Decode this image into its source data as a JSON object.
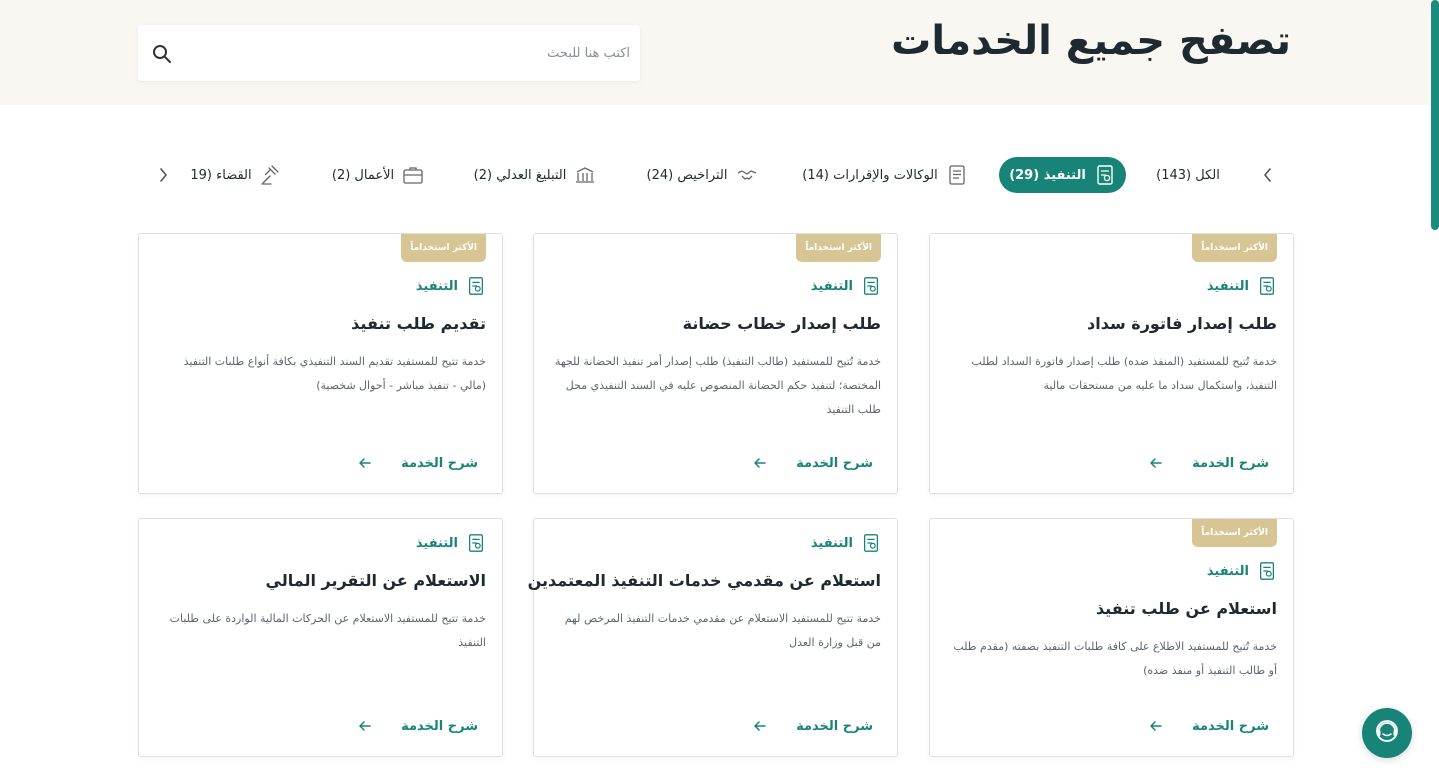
{
  "header": {
    "title": "تصفح جميع الخدمات",
    "search_placeholder": "اكتب هنا للبحث"
  },
  "colors": {
    "primary": "#188478",
    "badge": "#d8c594",
    "header_bg": "#f8f7f2"
  },
  "tabs": [
    {
      "label": "الكل (143)",
      "icon": null,
      "active": false
    },
    {
      "label": "التنفيذ (29)",
      "icon": "execution-doc-icon",
      "active": true
    },
    {
      "label": "الوكالات والإقرارات (14)",
      "icon": "document-lines-icon",
      "active": false
    },
    {
      "label": "التراخيص (24)",
      "icon": "handshake-icon",
      "active": false
    },
    {
      "label": "التبليغ العدلي (2)",
      "icon": "building-icon",
      "active": false
    },
    {
      "label": "الأعمال (2)",
      "icon": "briefcase-icon",
      "active": false
    },
    {
      "label": "القضاء (19",
      "icon": "gavel-icon",
      "active": false
    }
  ],
  "cards": [
    {
      "badge": "الأكثر استخداماً",
      "category": "التنفيذ",
      "title": "طلب إصدار فاتورة سداد",
      "desc": "خدمة تُتيح للمستفيد (المنفذ ضده) طلب إصدار فاتورة السداد لطلب التنفيذ، واستكمال سداد ما عليه من مستحقات مالية",
      "cta": "شرح الخدمة"
    },
    {
      "badge": "الأكثر استخداماً",
      "category": "التنفيذ",
      "title": "طلب إصدار خطاب حضانة",
      "desc": "خدمة تُتيح للمستفيد (طالب التنفيذ) طلب إصدار أمر تنفيذ الحضانة للجهة المختصة؛ لتنفيذ حكم الحضانة المنصوص عليه في السند التنفيذي محل طلب التنفيذ",
      "cta": "شرح الخدمة"
    },
    {
      "badge": "الأكثر استخداماً",
      "category": "التنفيذ",
      "title": "تقديم طلب تنفيذ",
      "desc": "خدمة تتيح للمستفيد تقديم السند التنفيذي بكافة أنواع طلبات التنفيذ (مالي - تنفيذ مباشر - أحوال شخصية)",
      "cta": "شرح الخدمة"
    },
    {
      "badge": "الأكثر استخداماً",
      "category": "التنفيذ",
      "title": "استعلام عن طلب تنفيذ",
      "desc": "خدمة تُتيح للمستفيد الاطلاع على كافة طلبات التنفيذ بصفته (مقدم طلب أو طالب التنفيذ أو منفذ ضده)",
      "cta": "شرح الخدمة"
    },
    {
      "badge": null,
      "category": "التنفيذ",
      "title": "استعلام عن مقدمي خدمات التنفيذ المعتمدين",
      "desc": "خدمة تتيح للمستفيد الاستعلام عن مقدمي خدمات التنفيذ المرخص لهم من قبل وزارة العدل",
      "cta": "شرح الخدمة"
    },
    {
      "badge": null,
      "category": "التنفيذ",
      "title": "الاستعلام عن التقرير المالي",
      "desc": "خدمة تتيح للمستفيد الاستعلام عن الحركات المالية الواردة على طلبات التنفيذ",
      "cta": "شرح الخدمة"
    }
  ]
}
